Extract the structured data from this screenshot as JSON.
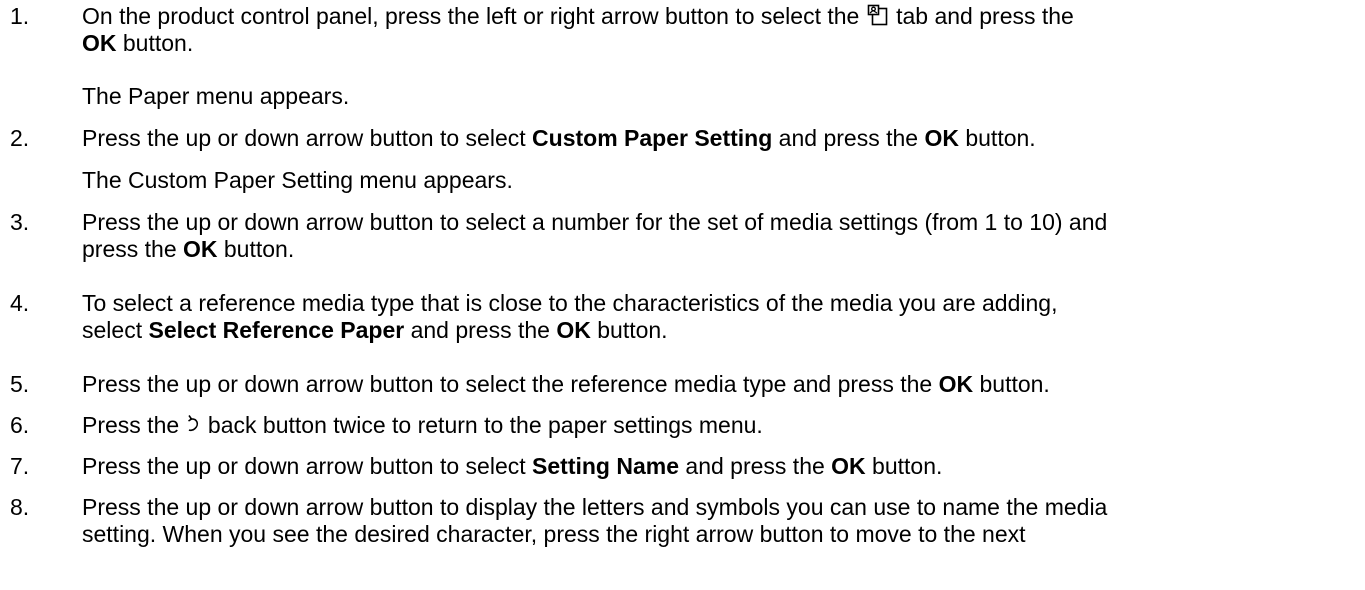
{
  "steps": [
    {
      "number": "1.",
      "l1_a": "On the product control panel, press the left or right arrow button to select the ",
      "icon": "paper-tab-icon",
      "l1_b": " tab and press the",
      "l2_bold": "OK",
      "l2_rest": " button.",
      "result": "The Paper menu appears."
    },
    {
      "number": "2.",
      "a": "Press the up or down arrow button to select ",
      "bold1": "Custom Paper Setting",
      "b": " and press the ",
      "bold2": "OK",
      "c": " button.",
      "result": "The Custom Paper Setting menu appears."
    },
    {
      "number": "3.",
      "l1": "Press the up or down arrow button to select a number for the set of media settings (from 1 to 10) and",
      "l2_a": "press the ",
      "l2_bold": "OK",
      "l2_b": " button."
    },
    {
      "number": "4.",
      "l1": "To select a reference media type that is close to the characteristics of the media you are adding,",
      "l2_a": "select ",
      "l2_bold1": "Select Reference Paper",
      "l2_b": " and press the ",
      "l2_bold2": "OK",
      "l2_c": " button."
    },
    {
      "number": "5.",
      "a": "Press the up or down arrow button to select the reference media type and press the ",
      "bold": "OK",
      "b": " button."
    },
    {
      "number": "6.",
      "a": "Press the ",
      "icon": "back-arrow-icon",
      "b": " back button twice to return to the paper settings menu."
    },
    {
      "number": "7.",
      "a": "Press the up or down arrow button to select ",
      "bold1": "Setting Name",
      "b": " and press the ",
      "bold2": "OK",
      "c": " button."
    },
    {
      "number": "8.",
      "l1": "Press the up or down arrow button to display the letters and symbols you can use to name the media",
      "l2": "setting. When you see the desired character, press the right arrow button to move to the next"
    }
  ]
}
